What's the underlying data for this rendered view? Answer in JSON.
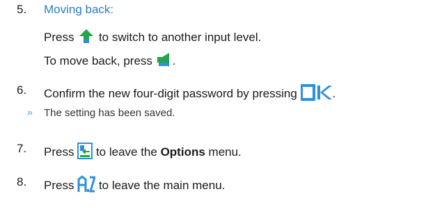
{
  "steps": [
    {
      "number": "5.",
      "title": "Moving back:",
      "line1": {
        "before": "Press",
        "after": "to switch to another input level."
      },
      "line2": {
        "before": "To move back, press",
        "after": "."
      }
    },
    {
      "number": "6.",
      "text": "Confirm the new four-digit password by pressing",
      "after": "."
    },
    {
      "result_marker": "»",
      "result_text": "The setting has been saved."
    },
    {
      "number": "7.",
      "before": "Press",
      "middle": "to leave the",
      "bold": "Options",
      "after": "menu."
    },
    {
      "number": "8.",
      "before": "Press",
      "after": "to leave the main menu."
    }
  ],
  "icons": {
    "shift": "shift-up-arrow-icon",
    "back": "back-speaker-icon",
    "ok": "ok-key-icon",
    "exit": "exit-menu-icon",
    "az": "a-z-key-icon"
  },
  "colors": {
    "heading_blue": "#2a7fc1",
    "marker_blue": "#4aa3df",
    "icon_blue": "#2f8fd8",
    "icon_green": "#27a34a"
  }
}
